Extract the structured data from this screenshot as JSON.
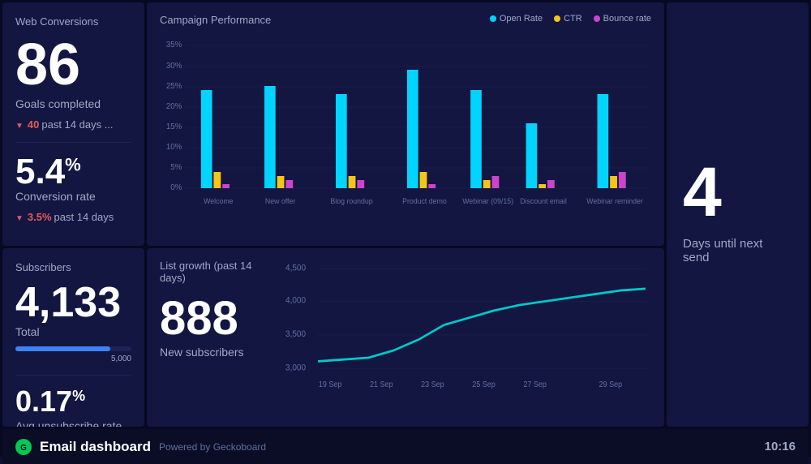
{
  "webConversions": {
    "title": "Web Conversions",
    "bigNumber": "86",
    "bigNumberLabel": "Goals completed",
    "trendValue": "40",
    "trendLabel": "past 14 days ...",
    "conversionRate": "5.4",
    "conversionRateLabel": "Conversion rate",
    "conversionTrend": "3.5%",
    "conversionTrendLabel": "past 14 days"
  },
  "campaignPerformance": {
    "title": "Campaign Performance",
    "legend": [
      {
        "label": "Open Rate",
        "color": "#00d4ff"
      },
      {
        "label": "CTR",
        "color": "#f5c518"
      },
      {
        "label": "Bounce rate",
        "color": "#cc44cc"
      }
    ],
    "yAxis": [
      "35%",
      "30%",
      "25%",
      "20%",
      "15%",
      "10%",
      "5%",
      "0%"
    ],
    "campaigns": [
      {
        "name": "Welcome",
        "openRate": 24,
        "ctr": 4,
        "bounce": 1
      },
      {
        "name": "New offer",
        "openRate": 25,
        "ctr": 3,
        "bounce": 2
      },
      {
        "name": "Blog roundup",
        "openRate": 23,
        "ctr": 3,
        "bounce": 2
      },
      {
        "name": "Product demo",
        "openRate": 29,
        "ctr": 4,
        "bounce": 1
      },
      {
        "name": "Webinar (09/15)",
        "openRate": 24,
        "ctr": 2,
        "bounce": 3
      },
      {
        "name": "Discount email",
        "openRate": 16,
        "ctr": 1,
        "bounce": 2
      },
      {
        "name": "Webinar reminder",
        "openRate": 23,
        "ctr": 3,
        "bounce": 4
      }
    ]
  },
  "subscribers": {
    "title": "Subscribers",
    "total": "4,133",
    "totalLabel": "Total",
    "progressValue": 4133,
    "progressMax": 5000,
    "progressLabel": "5,000",
    "unsubscribeRate": "0.17",
    "unsubscribeLabel": "Avg unsubscribe rate"
  },
  "listGrowth": {
    "title": "List growth (past 14 days)",
    "newSubscribers": "888",
    "newSubscribersLabel": "New subscribers",
    "xLabels": [
      "19 Sep",
      "21 Sep",
      "23 Sep",
      "25 Sep",
      "27 Sep",
      "29 Sep"
    ],
    "yLabels": [
      "4,500",
      "4,000",
      "3,500",
      "3,000"
    ],
    "dataPoints": [
      3100,
      3120,
      3150,
      3230,
      3350,
      3500,
      3600,
      3700,
      3780,
      3820,
      3870,
      3910,
      3960,
      4000
    ]
  },
  "nextSend": {
    "number": "4",
    "label": "Days until next send"
  },
  "footer": {
    "logo": "G",
    "title": "Email dashboard",
    "powered": "Powered by Geckoboard",
    "time": "10:16"
  }
}
